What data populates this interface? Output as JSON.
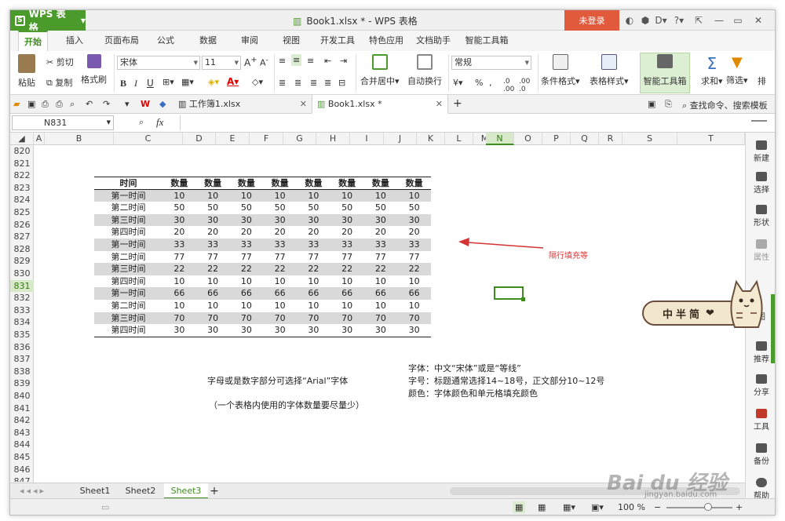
{
  "app": {
    "name": "WPS 表格",
    "window_title": "Book1.xlsx * - WPS 表格",
    "login_label": "未登录",
    "help_label": "?"
  },
  "colors": {
    "accent": "#4b9a2c",
    "login": "#e05a3b",
    "annotation": "#d33333",
    "row_shade": "#d9d9d9"
  },
  "ribbon_tabs": [
    "开始",
    "插入",
    "页面布局",
    "公式",
    "数据",
    "审阅",
    "视图",
    "开发工具",
    "特色应用",
    "文档助手",
    "智能工具箱"
  ],
  "ribbon": {
    "paste": "粘贴",
    "cut": "剪切",
    "copy": "复制",
    "format_painter": "格式刷",
    "font_name": "宋体",
    "font_size": "11",
    "merge_center": "合并居中",
    "wrap": "自动换行",
    "number_format": "常规",
    "conditional": "条件格式",
    "table_style": "表格样式",
    "smart_toolbox": "智能工具箱",
    "sum": "求和",
    "filter": "筛选",
    "sort": "排"
  },
  "doc_tabs": [
    {
      "label": "工作簿1.xlsx",
      "active": false
    },
    {
      "label": "Book1.xlsx *",
      "active": true
    }
  ],
  "search": {
    "label": "查找命令、搜索模板"
  },
  "formula_bar": {
    "name_box": "N831",
    "fx": "fx",
    "value": ""
  },
  "columns": [
    "A",
    "B",
    "C",
    "D",
    "E",
    "F",
    "G",
    "H",
    "I",
    "J",
    "K",
    "L",
    "M",
    "N",
    "O",
    "P",
    "Q",
    "R",
    "S",
    "T"
  ],
  "rows": [
    "820",
    "821",
    "822",
    "823",
    "824",
    "825",
    "826",
    "827",
    "828",
    "829",
    "830",
    "831",
    "832",
    "833",
    "834",
    "835",
    "836",
    "837",
    "838",
    "839",
    "840",
    "841",
    "842",
    "843",
    "844",
    "845",
    "846",
    "847"
  ],
  "selected_cell": {
    "col": "N",
    "row": "831"
  },
  "table": {
    "headers": [
      "时间",
      "数量",
      "数量",
      "数量",
      "数量",
      "数量",
      "数量",
      "数量",
      "数量"
    ],
    "rows": [
      {
        "label": "第一时间",
        "values": [
          "10",
          "10",
          "10",
          "10",
          "10",
          "10",
          "10",
          "10"
        ]
      },
      {
        "label": "第二时间",
        "values": [
          "50",
          "50",
          "50",
          "50",
          "50",
          "50",
          "50",
          "50"
        ]
      },
      {
        "label": "第三时间",
        "values": [
          "30",
          "30",
          "30",
          "30",
          "30",
          "30",
          "30",
          "30"
        ]
      },
      {
        "label": "第四时间",
        "values": [
          "20",
          "20",
          "20",
          "20",
          "20",
          "20",
          "20",
          "20"
        ]
      },
      {
        "label": "第一时间",
        "values": [
          "33",
          "33",
          "33",
          "33",
          "33",
          "33",
          "33",
          "33"
        ]
      },
      {
        "label": "第二时间",
        "values": [
          "77",
          "77",
          "77",
          "77",
          "77",
          "77",
          "77",
          "77"
        ]
      },
      {
        "label": "第三时间",
        "values": [
          "22",
          "22",
          "22",
          "22",
          "22",
          "22",
          "22",
          "22"
        ]
      },
      {
        "label": "第四时间",
        "values": [
          "10",
          "10",
          "10",
          "10",
          "10",
          "10",
          "10",
          "10"
        ]
      },
      {
        "label": "第一时间",
        "values": [
          "66",
          "66",
          "66",
          "66",
          "66",
          "66",
          "66",
          "66"
        ]
      },
      {
        "label": "第二时间",
        "values": [
          "10",
          "10",
          "10",
          "10",
          "10",
          "10",
          "10",
          "10"
        ]
      },
      {
        "label": "第三时间",
        "values": [
          "70",
          "70",
          "70",
          "70",
          "70",
          "70",
          "70",
          "70"
        ]
      },
      {
        "label": "第四时间",
        "values": [
          "30",
          "30",
          "30",
          "30",
          "30",
          "30",
          "30",
          "30"
        ]
      }
    ]
  },
  "annotation": "隔行填充等",
  "notes": {
    "left_1": "字母或是数字部分可选择“Arial”字体",
    "left_2": "（一个表格内使用的字体数量要尽量少）",
    "right_1": "字体：中文“宋体”或是“等线”",
    "right_2": "字号：标题通常选择14~18号，正文部分10~12号",
    "right_3": "颜色：字体颜色和单元格填充颜色"
  },
  "right_pane": [
    "新建",
    "选择",
    "形状",
    "属性",
    "",
    "图",
    "推荐",
    "分享",
    "工具",
    "备份",
    "帮助"
  ],
  "sticker": "中半简",
  "sheet_tabs": [
    {
      "label": "Sheet1",
      "active": false
    },
    {
      "label": "Sheet2",
      "active": false
    },
    {
      "label": "Sheet3",
      "active": true
    }
  ],
  "zoom": "100 %",
  "watermark": {
    "brand": "Bai du 经验",
    "url": "jingyan.baidu.com"
  }
}
